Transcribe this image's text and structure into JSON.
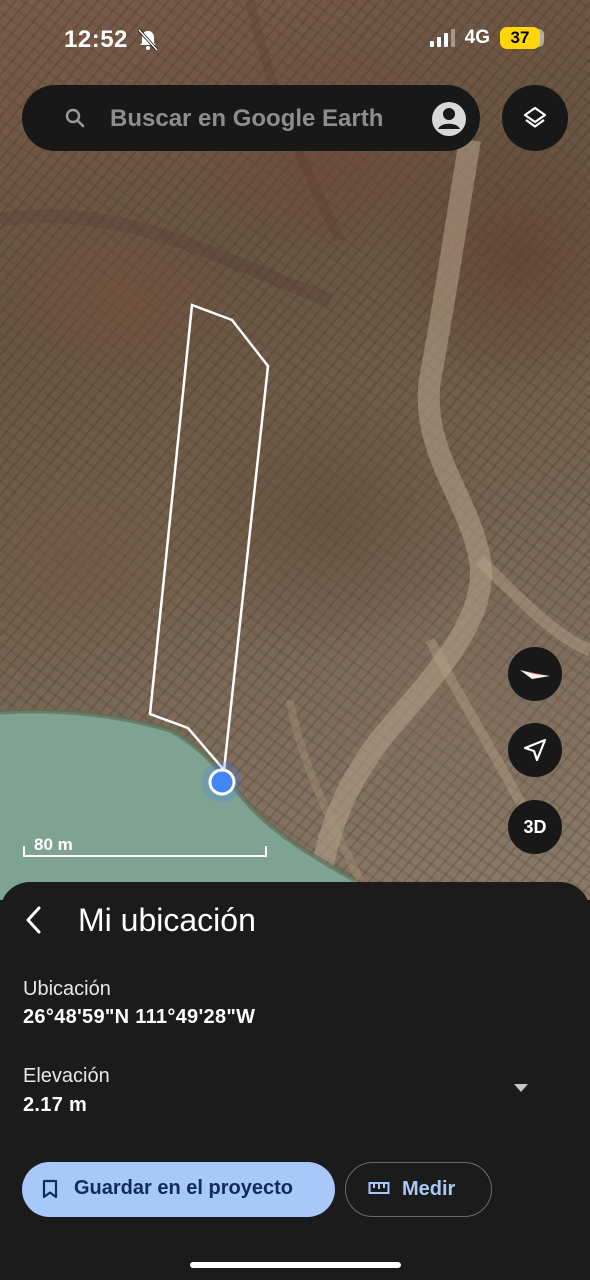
{
  "status_bar": {
    "time": "12:52",
    "network": "4G",
    "battery": "37",
    "icons": [
      "bell-slash-icon",
      "signal-icon",
      "battery-icon"
    ]
  },
  "search": {
    "placeholder": "Buscar en Google Earth",
    "icons": [
      "search-icon",
      "account-icon",
      "layers-icon"
    ]
  },
  "map": {
    "scale_label": "80 m",
    "buttons": {
      "three_d_label": "3D",
      "icons": [
        "compass-icon",
        "navigation-arrow-icon"
      ]
    },
    "colors": {
      "polygon_outline": "#ffffff",
      "location_dot": "#4285f4",
      "water": "#7ea393"
    }
  },
  "panel": {
    "title": "Mi ubicación",
    "location_label": "Ubicación",
    "location_value": "26°48'59\"N 111°49'28\"W",
    "elevation_label": "Elevación",
    "elevation_value": "2.17 m",
    "save_button": "Guardar en el proyecto",
    "measure_button": "Medir",
    "colors": {
      "primary_button_bg": "#a9c8fa",
      "accent_text": "#a9c8fa"
    },
    "icons": [
      "back-arrow-icon",
      "bookmark-icon",
      "ruler-icon",
      "chevron-down-icon"
    ]
  }
}
